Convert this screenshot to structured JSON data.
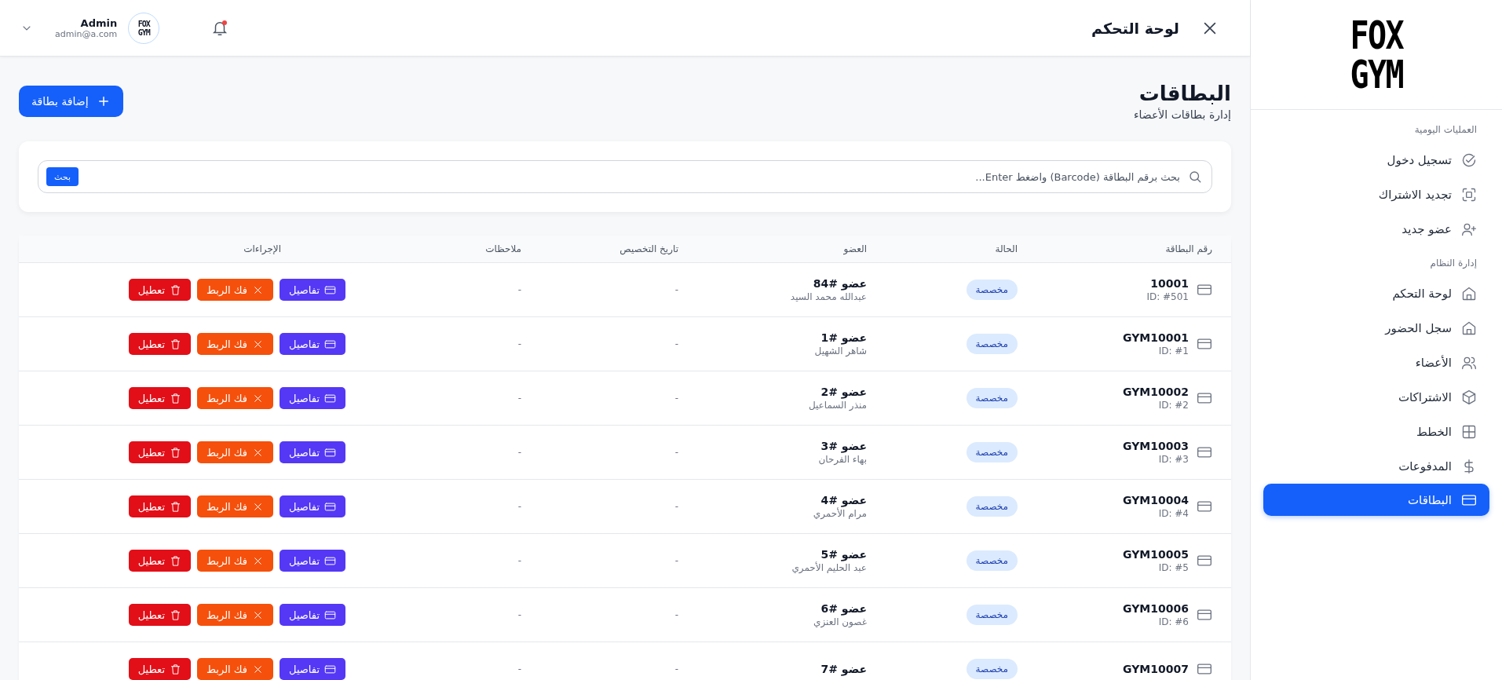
{
  "sidebar": {
    "logo": [
      "FOX",
      "GYM"
    ],
    "sections": [
      {
        "title": "العمليات اليومية",
        "items": [
          {
            "label": "تسجيل دخول",
            "kind": "checkin",
            "selected": false
          },
          {
            "label": "تجديد الاشتراك",
            "kind": "renew",
            "selected": false
          },
          {
            "label": "عضو جديد",
            "kind": "new-member",
            "selected": false
          }
        ]
      },
      {
        "title": "إدارة النظام",
        "items": [
          {
            "label": "لوحة التحكم",
            "kind": "home",
            "selected": false
          },
          {
            "label": "سجل الحضور",
            "kind": "home",
            "selected": false
          },
          {
            "label": "الأعضاء",
            "kind": "members",
            "selected": false
          },
          {
            "label": "الاشتراكات",
            "kind": "cube",
            "selected": false
          },
          {
            "label": "الخطط",
            "kind": "grid",
            "selected": false
          },
          {
            "label": "المدفوعات",
            "kind": "dollar",
            "selected": false
          },
          {
            "label": "البطاقات",
            "kind": "card",
            "selected": true
          }
        ]
      }
    ]
  },
  "topbar": {
    "title": "لوحة التحكم",
    "notifications_unread": true,
    "user": {
      "name": "Admin",
      "email": "admin@a.com",
      "avatar": [
        "FOX",
        "GYM"
      ]
    }
  },
  "page": {
    "title": "البطاقات",
    "subtitle": "إدارة بطاقات الأعضاء",
    "add_button": "إضافة بطاقة"
  },
  "search": {
    "placeholder": "بحث برقم البطاقة (Barcode) واضغط Enter...",
    "button": "بحث"
  },
  "table": {
    "columns": [
      "رقم البطاقة",
      "الحالة",
      "العضو",
      "تاريخ التخصيص",
      "ملاحظات",
      "الإجراءات"
    ],
    "rows": [
      {
        "card": "10001",
        "id": "ID: #501",
        "status": "مخصصة",
        "member": "عضو #84",
        "member_name": "عبدالله محمد السيد",
        "date": "-",
        "notes": "-",
        "actions": [
          {
            "kind": "details",
            "label": "تفاصيل"
          },
          {
            "kind": "unlink",
            "label": "فك الربط"
          },
          {
            "kind": "disable",
            "label": "تعطيل"
          }
        ]
      },
      {
        "card": "GYM10001",
        "id": "ID: #1",
        "status": "مخصصة",
        "member": "عضو #1",
        "member_name": "شاهر الشهيل",
        "date": "-",
        "notes": "-",
        "actions": [
          {
            "kind": "details",
            "label": "تفاصيل"
          },
          {
            "kind": "unlink",
            "label": "فك الربط"
          },
          {
            "kind": "disable",
            "label": "تعطيل"
          }
        ]
      },
      {
        "card": "GYM10002",
        "id": "ID: #2",
        "status": "مخصصة",
        "member": "عضو #2",
        "member_name": "منذر السماعيل",
        "date": "-",
        "notes": "-",
        "actions": [
          {
            "kind": "details",
            "label": "تفاصيل"
          },
          {
            "kind": "unlink",
            "label": "فك الربط"
          },
          {
            "kind": "disable",
            "label": "تعطيل"
          }
        ]
      },
      {
        "card": "GYM10003",
        "id": "ID: #3",
        "status": "مخصصة",
        "member": "عضو #3",
        "member_name": "بهاء الفرحان",
        "date": "-",
        "notes": "-",
        "actions": [
          {
            "kind": "details",
            "label": "تفاصيل"
          },
          {
            "kind": "unlink",
            "label": "فك الربط"
          },
          {
            "kind": "disable",
            "label": "تعطيل"
          }
        ]
      },
      {
        "card": "GYM10004",
        "id": "ID: #4",
        "status": "مخصصة",
        "member": "عضو #4",
        "member_name": "مرام الأحمري",
        "date": "-",
        "notes": "-",
        "actions": [
          {
            "kind": "details",
            "label": "تفاصيل"
          },
          {
            "kind": "unlink",
            "label": "فك الربط"
          },
          {
            "kind": "disable",
            "label": "تعطيل"
          }
        ]
      },
      {
        "card": "GYM10005",
        "id": "ID: #5",
        "status": "مخصصة",
        "member": "عضو #5",
        "member_name": "عبد الحليم الأحمري",
        "date": "-",
        "notes": "-",
        "actions": [
          {
            "kind": "details",
            "label": "تفاصيل"
          },
          {
            "kind": "unlink",
            "label": "فك الربط"
          },
          {
            "kind": "disable",
            "label": "تعطيل"
          }
        ]
      },
      {
        "card": "GYM10006",
        "id": "ID: #6",
        "status": "مخصصة",
        "member": "عضو #6",
        "member_name": "غصون العنزي",
        "date": "-",
        "notes": "-",
        "actions": [
          {
            "kind": "details",
            "label": "تفاصيل"
          },
          {
            "kind": "unlink",
            "label": "فك الربط"
          },
          {
            "kind": "disable",
            "label": "تعطيل"
          }
        ]
      },
      {
        "card": "GYM10007",
        "status": "مخصصة",
        "member": "عضو #7",
        "date": "-",
        "notes": "-",
        "actions": [
          {
            "kind": "details",
            "label": "تفاصيل"
          },
          {
            "kind": "unlink",
            "label": "فك الربط"
          },
          {
            "kind": "disable",
            "label": "تعطيل"
          }
        ]
      }
    ]
  }
}
